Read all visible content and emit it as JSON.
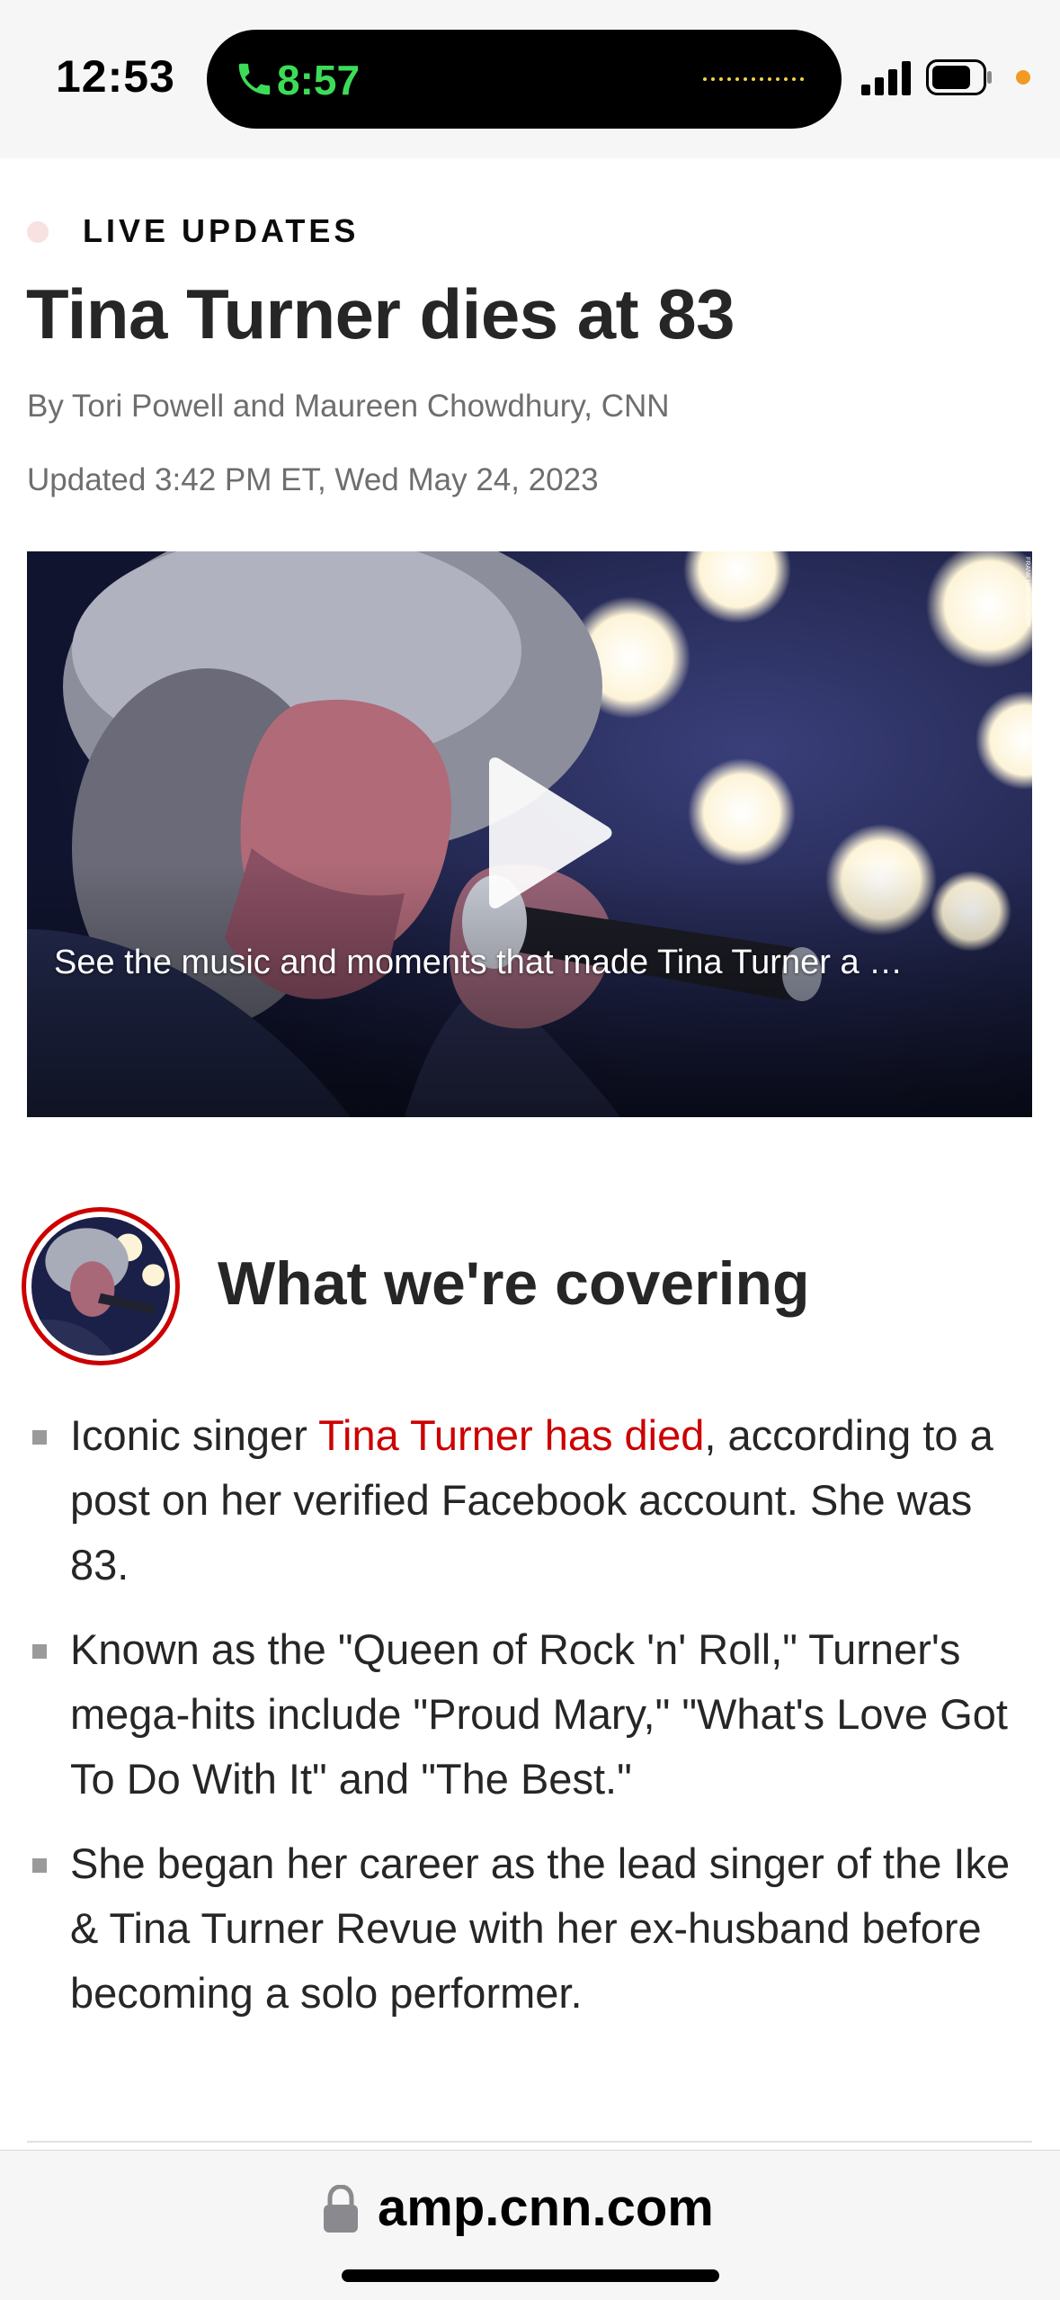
{
  "status_bar": {
    "time": "12:53",
    "call_timer": "8:57",
    "call_color": "#3ddc57",
    "privacy_dot_color": "#f29b24",
    "icons": [
      "phone-icon",
      "signal-icon",
      "battery-icon"
    ]
  },
  "article": {
    "live_label": "LIVE UPDATES",
    "headline": "Tina Turner dies at 83",
    "byline": "By Tori Powell and Maureen Chowdhury, CNN",
    "updated": "Updated 3:42 PM ET, Wed May 24, 2023",
    "video": {
      "caption": "See the music and moments that made Tina Turner a …",
      "play_icon": "play-icon"
    }
  },
  "covering": {
    "title": "What we're covering",
    "bullets": [
      {
        "before": "Iconic singer ",
        "link": "Tina Turner has died",
        "after": ", according to a post on her verified Facebook account. She was 83."
      },
      {
        "text": "Known as the \"Queen of Rock 'n' Roll,\" Turner's mega-hits include \"Proud Mary,\" \"What's Love Got To Do With It\" and \"The Best.\""
      },
      {
        "text": "She began her career as the lead singer of the Ike & Tina Turner Revue with her ex-husband before becoming a solo performer."
      }
    ]
  },
  "url_bar": {
    "url": "amp.cnn.com",
    "lock_icon": "lock-icon"
  },
  "colors": {
    "accent_red": "#cc0000",
    "text": "#262626",
    "muted": "#6e6e6e"
  }
}
